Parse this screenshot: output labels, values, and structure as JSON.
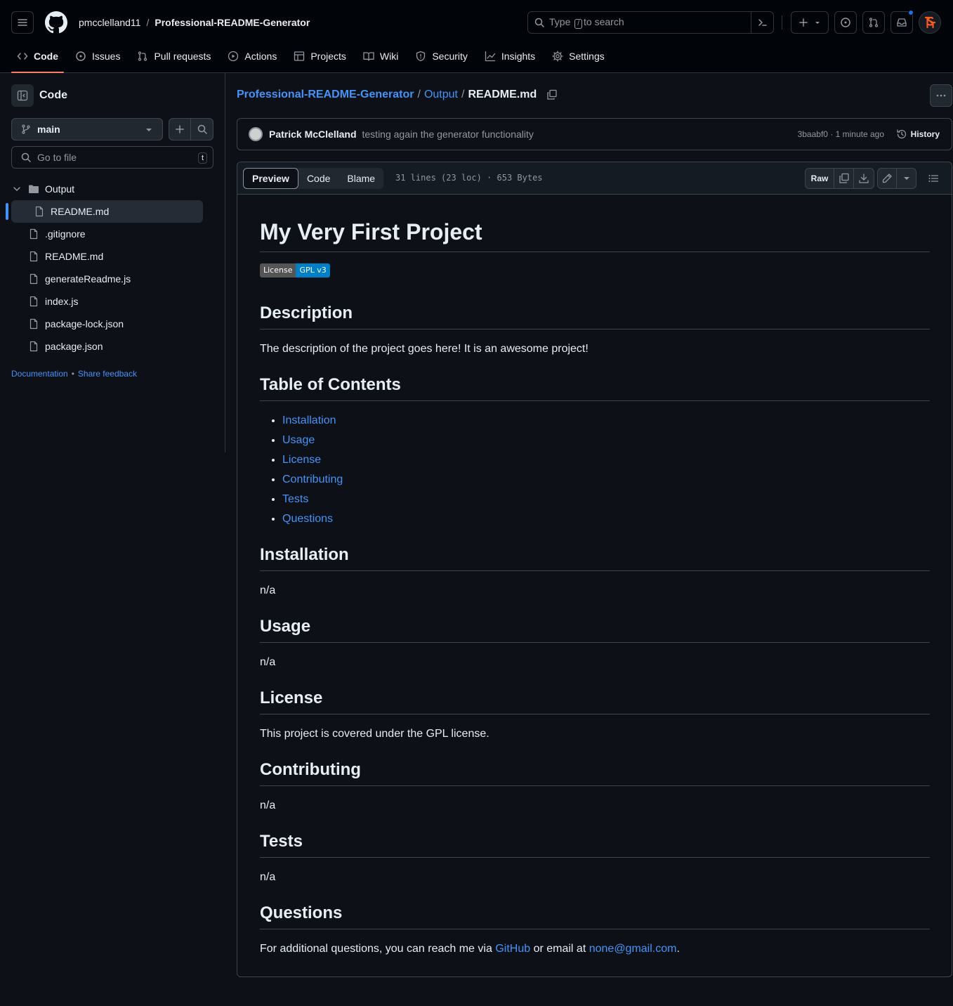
{
  "header": {
    "owner": "pmcclelland11",
    "separator": "/",
    "repo": "Professional-README-Generator",
    "search_prefix": "Type",
    "search_key": "/",
    "search_suffix": "to search"
  },
  "nav": [
    {
      "label": "Code",
      "icon": "code-icon",
      "active": true
    },
    {
      "label": "Issues",
      "icon": "issue-icon"
    },
    {
      "label": "Pull requests",
      "icon": "pull-request-icon"
    },
    {
      "label": "Actions",
      "icon": "play-icon"
    },
    {
      "label": "Projects",
      "icon": "table-icon"
    },
    {
      "label": "Wiki",
      "icon": "book-icon"
    },
    {
      "label": "Security",
      "icon": "shield-icon"
    },
    {
      "label": "Insights",
      "icon": "graph-icon"
    },
    {
      "label": "Settings",
      "icon": "gear-icon"
    }
  ],
  "sidebar": {
    "title": "Code",
    "branch": "main",
    "goto_placeholder": "Go to file",
    "goto_key": "t",
    "tree": [
      {
        "name": "Output",
        "type": "folder"
      },
      {
        "name": "README.md",
        "type": "file",
        "child": true,
        "selected": true
      },
      {
        "name": ".gitignore",
        "type": "file"
      },
      {
        "name": "README.md",
        "type": "file"
      },
      {
        "name": "generateReadme.js",
        "type": "file"
      },
      {
        "name": "index.js",
        "type": "file"
      },
      {
        "name": "package-lock.json",
        "type": "file"
      },
      {
        "name": "package.json",
        "type": "file"
      }
    ],
    "footer": {
      "documentation": "Documentation",
      "dot": "•",
      "feedback": "Share feedback"
    }
  },
  "path": {
    "repo": "Professional-README-Generator",
    "folder": "Output",
    "file": "README.md",
    "sep": "/"
  },
  "commit": {
    "author": "Patrick McClelland",
    "message": "testing again the generator functionality",
    "meta": "3baabf0 · 1 minute ago",
    "history": "History"
  },
  "file": {
    "tabs": [
      "Preview",
      "Code",
      "Blame"
    ],
    "meta": "31 lines (23 loc) · 653 Bytes",
    "raw": "Raw"
  },
  "readme": {
    "title": "My Very First Project",
    "badge_left": "License",
    "badge_right": "GPL v3",
    "desc_h": "Description",
    "desc": "The description of the project goes here! It is an awesome project!",
    "toc_h": "Table of Contents",
    "toc": [
      "Installation",
      "Usage",
      "License",
      "Contributing",
      "Tests",
      "Questions"
    ],
    "install_h": "Installation",
    "install": "n/a",
    "usage_h": "Usage",
    "usage": "n/a",
    "license_h": "License",
    "license": "This project is covered under the GPL license.",
    "contrib_h": "Contributing",
    "contrib": "n/a",
    "tests_h": "Tests",
    "tests": "n/a",
    "questions_h": "Questions",
    "questions_pre": "For additional questions, you can reach me via",
    "questions_link1": "GitHub",
    "questions_mid": "or email at",
    "questions_link2": "none@gmail.com",
    "questions_end": "."
  },
  "colors": {
    "accent": "#4493f8",
    "underline": "#f78166",
    "bg": "#0d1117"
  }
}
